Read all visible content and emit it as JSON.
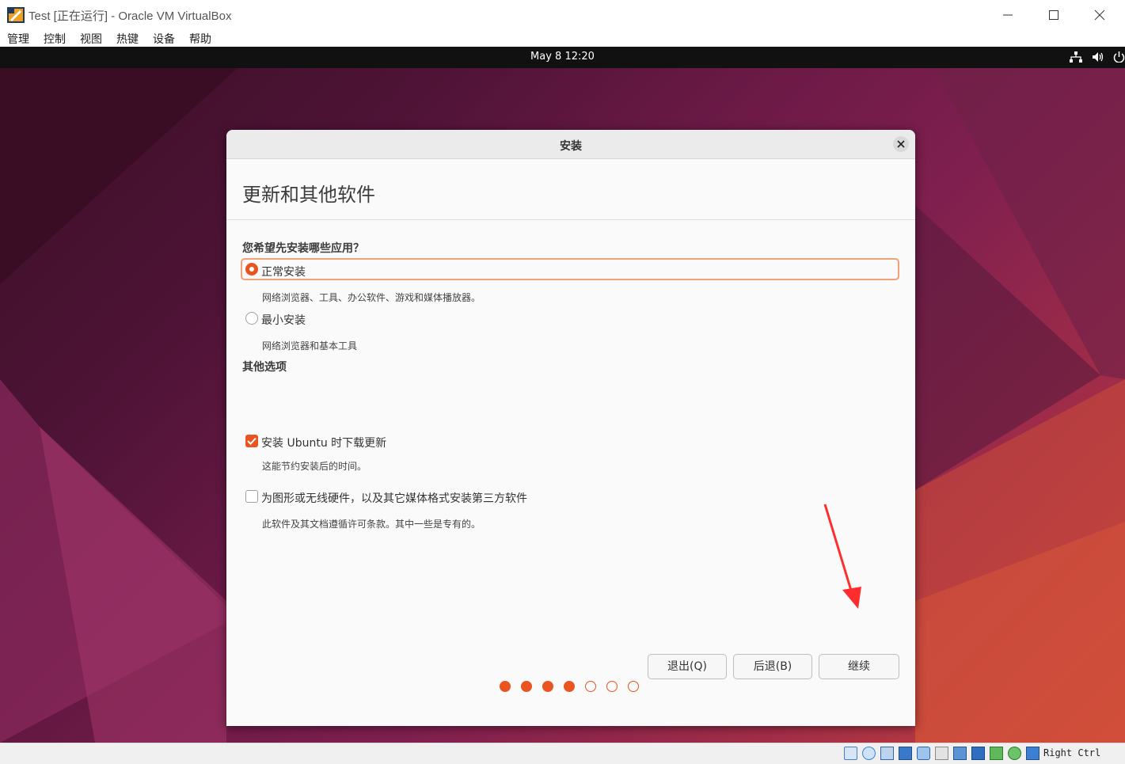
{
  "window": {
    "title": "Test [正在运行] - Oracle VM VirtualBox",
    "icon": "virtualbox-icon",
    "controls": [
      "minimize-icon",
      "maximize-icon",
      "close-icon"
    ]
  },
  "menubar": {
    "items": [
      "管理",
      "控制",
      "视图",
      "热键",
      "设备",
      "帮助"
    ]
  },
  "vm": {
    "clock": "May 8  12:20",
    "tray_icons": [
      "network-icon",
      "volume-icon",
      "power-icon"
    ]
  },
  "dialog": {
    "title": "安装",
    "page_title": "更新和其他软件",
    "question": "您希望先安装哪些应用？",
    "install_options": [
      {
        "label": "正常安装",
        "desc": "网络浏览器、工具、办公软件、游戏和媒体播放器。",
        "selected": true
      },
      {
        "label": "最小安装",
        "desc": "网络浏览器和基本工具",
        "selected": false
      }
    ],
    "other_heading": "其他选项",
    "other_options": [
      {
        "label": "安装 Ubuntu 时下载更新",
        "desc": "这能节约安装后的时间。",
        "checked": true
      },
      {
        "label": "为图形或无线硬件，以及其它媒体格式安装第三方软件",
        "desc": "此软件及其文档遵循许可条款。其中一些是专有的。",
        "checked": false
      }
    ],
    "buttons": {
      "quit": "退出(Q)",
      "back": "后退(B)",
      "continue": "继续"
    },
    "progress": {
      "total": 7,
      "filled": 4
    },
    "accent": "#E95420"
  },
  "statusbar": {
    "icons": [
      "hard-disk-icon",
      "optical-disk-icon",
      "audio-icon",
      "network-adapter-icon",
      "usb-icon",
      "shared-folder-icon",
      "display-icon",
      "recording-icon",
      "cpu-icon",
      "guest-additions-icon",
      "mouse-integration-icon",
      "keyboard-capture-icon"
    ],
    "host_key": "Right Ctrl"
  }
}
